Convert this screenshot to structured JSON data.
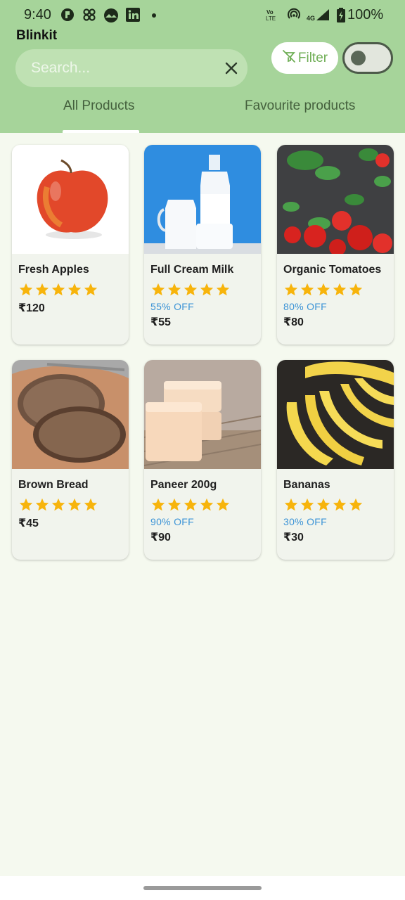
{
  "status_bar": {
    "time": "9:40",
    "network_label": "4G",
    "volte_label": "Vo LTE",
    "battery": "100%"
  },
  "app": {
    "title": "Blinkit"
  },
  "search": {
    "placeholder": "Search...",
    "value": ""
  },
  "filter": {
    "label": "Filter",
    "icon": "filter-off-icon"
  },
  "toggle": {
    "state": "off"
  },
  "tabs": [
    {
      "label": "All Products",
      "active": true
    },
    {
      "label": "Favourite products",
      "active": false
    }
  ],
  "products": [
    {
      "name": "Fresh Apples",
      "rating": 5,
      "discount": "",
      "price": "₹120",
      "image": "apple"
    },
    {
      "name": "Full Cream Milk",
      "rating": 5,
      "discount": "55% OFF",
      "price": "₹55",
      "image": "milk"
    },
    {
      "name": "Organic Tomatoes",
      "rating": 5,
      "discount": "80% OFF",
      "price": "₹80",
      "image": "tomatoes"
    },
    {
      "name": "Brown Bread",
      "rating": 5,
      "discount": "",
      "price": "₹45",
      "image": "bread"
    },
    {
      "name": "Paneer 200g",
      "rating": 5,
      "discount": "90% OFF",
      "price": "₹90",
      "image": "paneer"
    },
    {
      "name": "Bananas",
      "rating": 5,
      "discount": "30% OFF",
      "price": "₹30",
      "image": "bananas"
    }
  ],
  "colors": {
    "header": "#a6d49a",
    "accent": "#6fae56",
    "star": "#f7b40c",
    "discount": "#3b93d6",
    "background": "#f5f9ef"
  }
}
